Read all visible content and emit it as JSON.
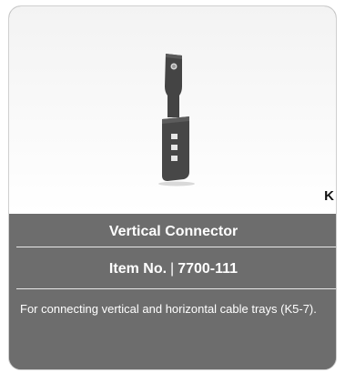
{
  "product": {
    "badge": "K",
    "title": "Vertical Connector",
    "item_label": "Item No.",
    "item_separator": "|",
    "item_number": "7700-111",
    "description": "For connecting vertical and horizontal cable trays (K5-7).",
    "image_icon": "vertical-connector-bracket",
    "colors": {
      "panel": "#6d6d6d",
      "text": "#ffffff",
      "part": "#3f3f3f"
    }
  }
}
